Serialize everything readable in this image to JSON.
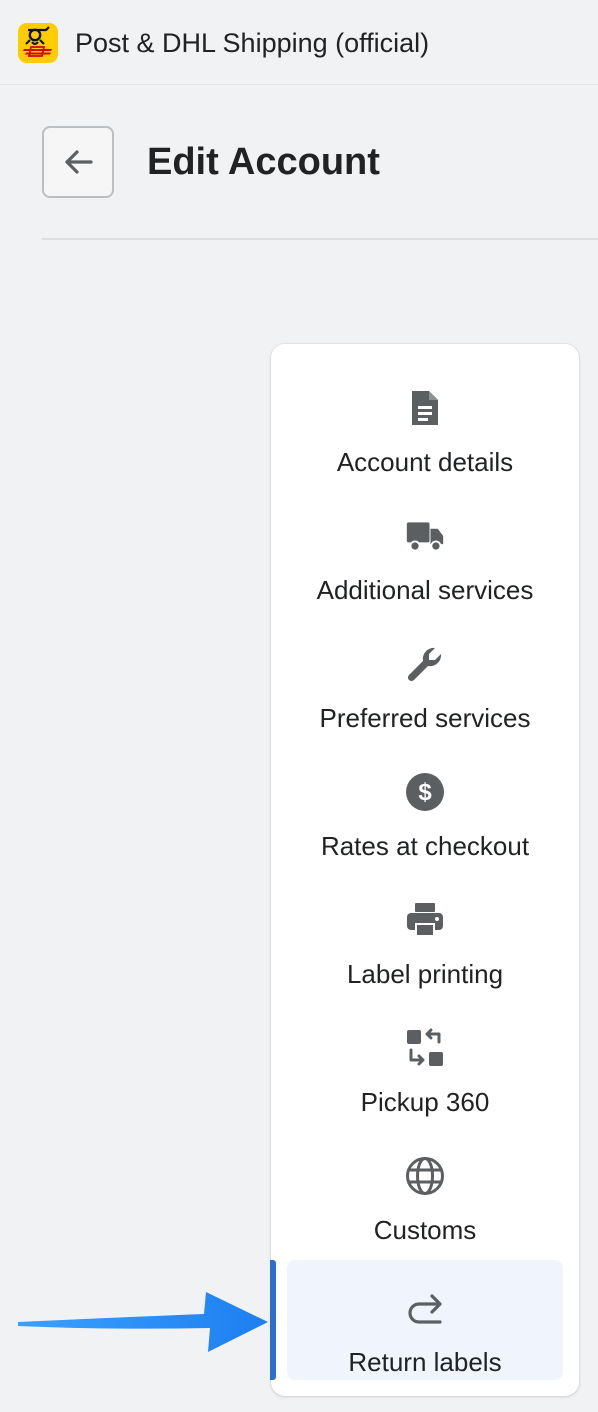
{
  "app": {
    "title": "Post & DHL Shipping (official)",
    "logo_icon": "dhl-post-horn-logo",
    "brand_colors": {
      "yellow": "#ffcc00",
      "red": "#d40511"
    }
  },
  "page": {
    "title": "Edit Account",
    "back_icon": "arrow-left-icon"
  },
  "nav": {
    "accent_color": "#2c6ecb",
    "selected_index": 7,
    "items": [
      {
        "label": "Account details",
        "icon": "document-icon"
      },
      {
        "label": "Additional services",
        "icon": "truck-icon"
      },
      {
        "label": "Preferred services",
        "icon": "wrench-icon"
      },
      {
        "label": "Rates at checkout",
        "icon": "dollar-circle-icon"
      },
      {
        "label": "Label printing",
        "icon": "printer-icon"
      },
      {
        "label": "Pickup 360",
        "icon": "swap-icon"
      },
      {
        "label": "Customs",
        "icon": "globe-icon"
      },
      {
        "label": "Return labels",
        "icon": "return-arrow-icon"
      }
    ]
  },
  "annotation": {
    "pointer_icon": "blue-pointer-arrow",
    "color": "#1e90ff"
  }
}
